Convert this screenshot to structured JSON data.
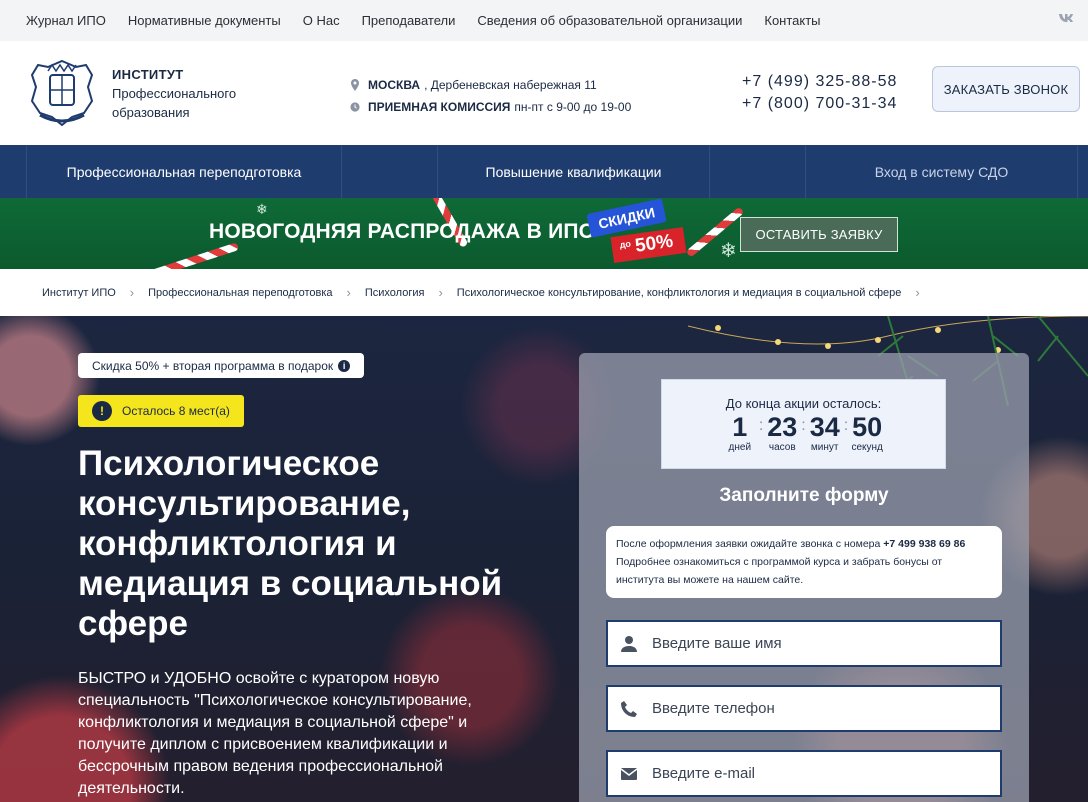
{
  "topnav": {
    "items": [
      "Журнал ИПО",
      "Нормативные документы",
      "О Нас",
      "Преподаватели",
      "Сведения об образовательной организации",
      "Контакты"
    ],
    "social": "vk"
  },
  "header": {
    "logo_line1": "ИНСТИТУТ",
    "logo_line2": "Профессионального",
    "logo_line3": "образования",
    "address_city": "МОСКВА",
    "address_street": ", Дербеневская набережная 11",
    "admissions_label": "ПРИЕМНАЯ КОМИССИЯ",
    "admissions_hours": "пн-пт с 9-00 до 19-00",
    "phone1": "+7 (499) 325-88-58",
    "phone2": "+7 (800) 700-31-34",
    "call_button": "ЗАКАЗАТЬ ЗВОНОК"
  },
  "mainnav": {
    "items": [
      "Профессиональная переподготовка",
      "Повышение квалификации",
      "",
      "Вход в систему СДО"
    ]
  },
  "promo": {
    "title": "НОВОГОДНЯЯ РАСПРОДАЖА В ИПО",
    "badge1": "СКИДКИ",
    "badge2_prefix": "до",
    "badge2_value": "50%",
    "button": "ОСТАВИТЬ ЗАЯВКУ"
  },
  "breadcrumb": {
    "items": [
      "Институт ИПО",
      "Профессиональная переподготовка",
      "Психология",
      "Психологическое консультирование, конфликтология и медиация в социальной сфере"
    ]
  },
  "hero": {
    "discount_pill": "Скидка 50% + вторая программа в подарок",
    "seats_pill": "Осталось 8 мест(а)",
    "title": "Психологическое консультирование, конфликтология и медиация в социальной сфере",
    "description": "БЫСТРО и УДОБНО освойте с куратором новую специальность \"Психологическое консультирование, конфликтология и медиация в социальной сфере\" и получите диплом с присвоением квалификации и бессрочным правом ведения профессиональной деятельности."
  },
  "timer": {
    "title": "До конца акции осталось:",
    "days": "1",
    "days_label": "дней",
    "hours": "23",
    "hours_label": "часов",
    "minutes": "34",
    "minutes_label": "минут",
    "seconds": "50",
    "seconds_label": "секунд"
  },
  "form": {
    "title": "Заполните форму",
    "note_prefix": "После оформления заявки ожидайте звонка с номера",
    "note_phone": "+7 499 938 69 86",
    "note_rest": "Подробнее ознакомиться с программой курса и забрать бонусы от института вы можете на нашем сайте.",
    "name_placeholder": "Введите ваше имя",
    "phone_placeholder": "Введите телефон",
    "email_placeholder": "Введите e-mail"
  },
  "colors": {
    "nav_bg": "#1f3c6f",
    "promo_green": "#0f6a37",
    "seats_yellow": "#f4e51c",
    "text_dark": "#1b2a44"
  }
}
